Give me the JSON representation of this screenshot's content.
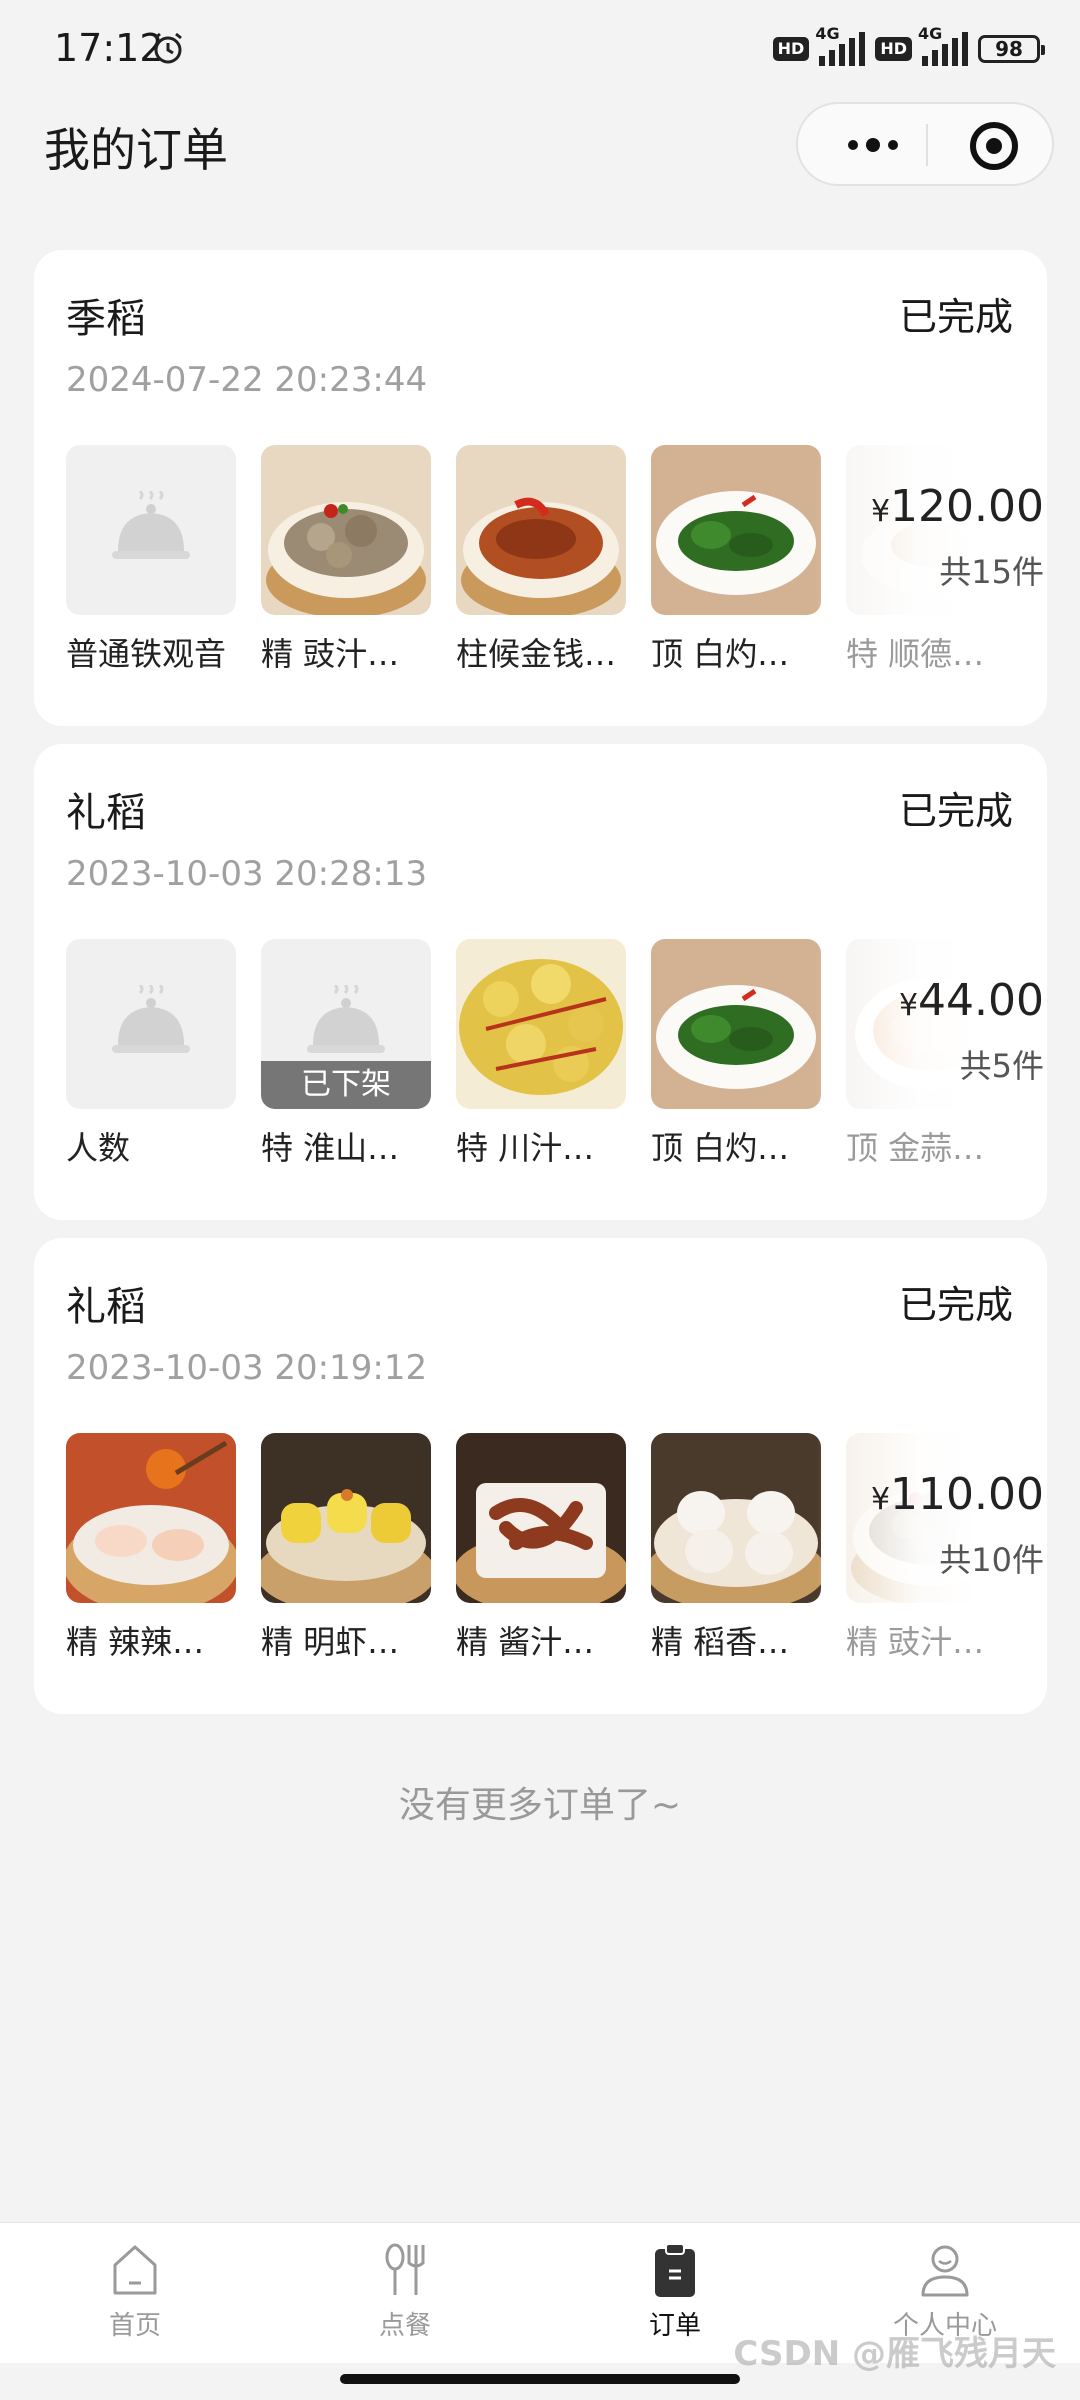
{
  "status_bar": {
    "time": "17:12",
    "hd1": "HD",
    "net1": "4G",
    "hd2": "HD",
    "net2": "4G",
    "battery": "98"
  },
  "header": {
    "title": "我的订单"
  },
  "orders": [
    {
      "shop": "季稻",
      "status": "已完成",
      "time": "2024-07-22 20:23:44",
      "items": [
        {
          "name": "普通铁观音",
          "image": "placeholder"
        },
        {
          "name": "精 豉汁…",
          "image": "steamed-pork-ribs"
        },
        {
          "name": "柱候金钱…",
          "image": "braised-tripe"
        },
        {
          "name": "顶 白灼…",
          "image": "boiled-greens"
        },
        {
          "name": "特 顺德…",
          "image": "dish"
        }
      ],
      "total_symbol": "¥",
      "total": "120.00",
      "count": "共15件"
    },
    {
      "shop": "礼稻",
      "status": "已完成",
      "time": "2023-10-03 20:28:13",
      "items": [
        {
          "name": "人数",
          "image": "placeholder"
        },
        {
          "name": "特 淮山…",
          "image": "placeholder",
          "badge": "已下架"
        },
        {
          "name": "特 川汁…",
          "image": "chili-wontons"
        },
        {
          "name": "顶 白灼…",
          "image": "boiled-greens"
        },
        {
          "name": "顶 金蒜…",
          "image": "soup"
        }
      ],
      "total_symbol": "¥",
      "total": "44.00",
      "count": "共5件"
    },
    {
      "shop": "礼稻",
      "status": "已完成",
      "time": "2023-10-03 20:19:12",
      "items": [
        {
          "name": "精 辣辣…",
          "image": "crystal-dumplings"
        },
        {
          "name": "精 明虾…",
          "image": "shumai"
        },
        {
          "name": "精 酱汁…",
          "image": "chicken-feet"
        },
        {
          "name": "精 稻香…",
          "image": "har-gow"
        },
        {
          "name": "精 豉汁…",
          "image": "steamed-pork-ribs"
        }
      ],
      "total_symbol": "¥",
      "total": "110.00",
      "count": "共10件"
    }
  ],
  "footer_text": "没有更多订单了~",
  "tabs": [
    {
      "label": "首页",
      "icon": "home-icon"
    },
    {
      "label": "点餐",
      "icon": "utensils-icon"
    },
    {
      "label": "订单",
      "icon": "clipboard-icon",
      "active": true
    },
    {
      "label": "个人中心",
      "icon": "user-icon"
    }
  ],
  "watermark": "CSDN @雁飞残月天"
}
